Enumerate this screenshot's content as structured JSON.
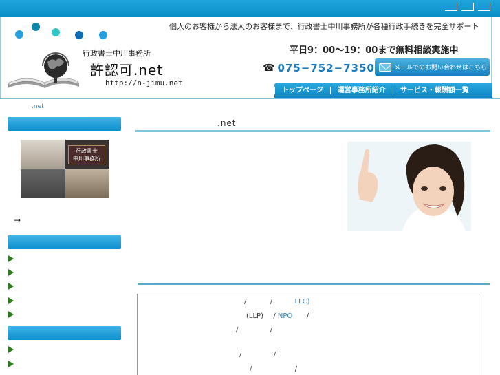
{
  "header": {
    "tagline": "個人のお客様から法人のお客様まで、行政書士中川事務所が各種行政手続きを完全サポート",
    "hours": "平日9：00〜19：00まで無料相談実施中",
    "office_name": "行政書士中川事務所",
    "site_title": "許認可.net",
    "site_url": "http://n-jimu.net",
    "phone_icon": "phone-icon",
    "phone": "075−752−7350",
    "mail_button": "メールでのお問い合わせはこちら",
    "brand_color": "#0c8ec9"
  },
  "nav": {
    "items": [
      "トップページ",
      "運営事務所紹介",
      "サービス・報酬額一覧"
    ]
  },
  "breadcrumb": ".net",
  "sidebar": {
    "arrow": "→",
    "photo_plaque": [
      "行政書士",
      "中川事務所"
    ]
  },
  "main": {
    "title": ".net"
  },
  "box": {
    "line1_slash1": "/",
    "line1_slash2": "/",
    "line1_llc": "LLC)",
    "line2_llp": "(LLP)",
    "line2_slash1": "/",
    "line2_npo": "NPO",
    "line2_slash2": "/",
    "line3_slash1": "/",
    "line3_slash2": "/",
    "line4_slash1": "/",
    "line4_slash2": "/",
    "line5_slash1": "/",
    "line5_slash2": "/"
  }
}
